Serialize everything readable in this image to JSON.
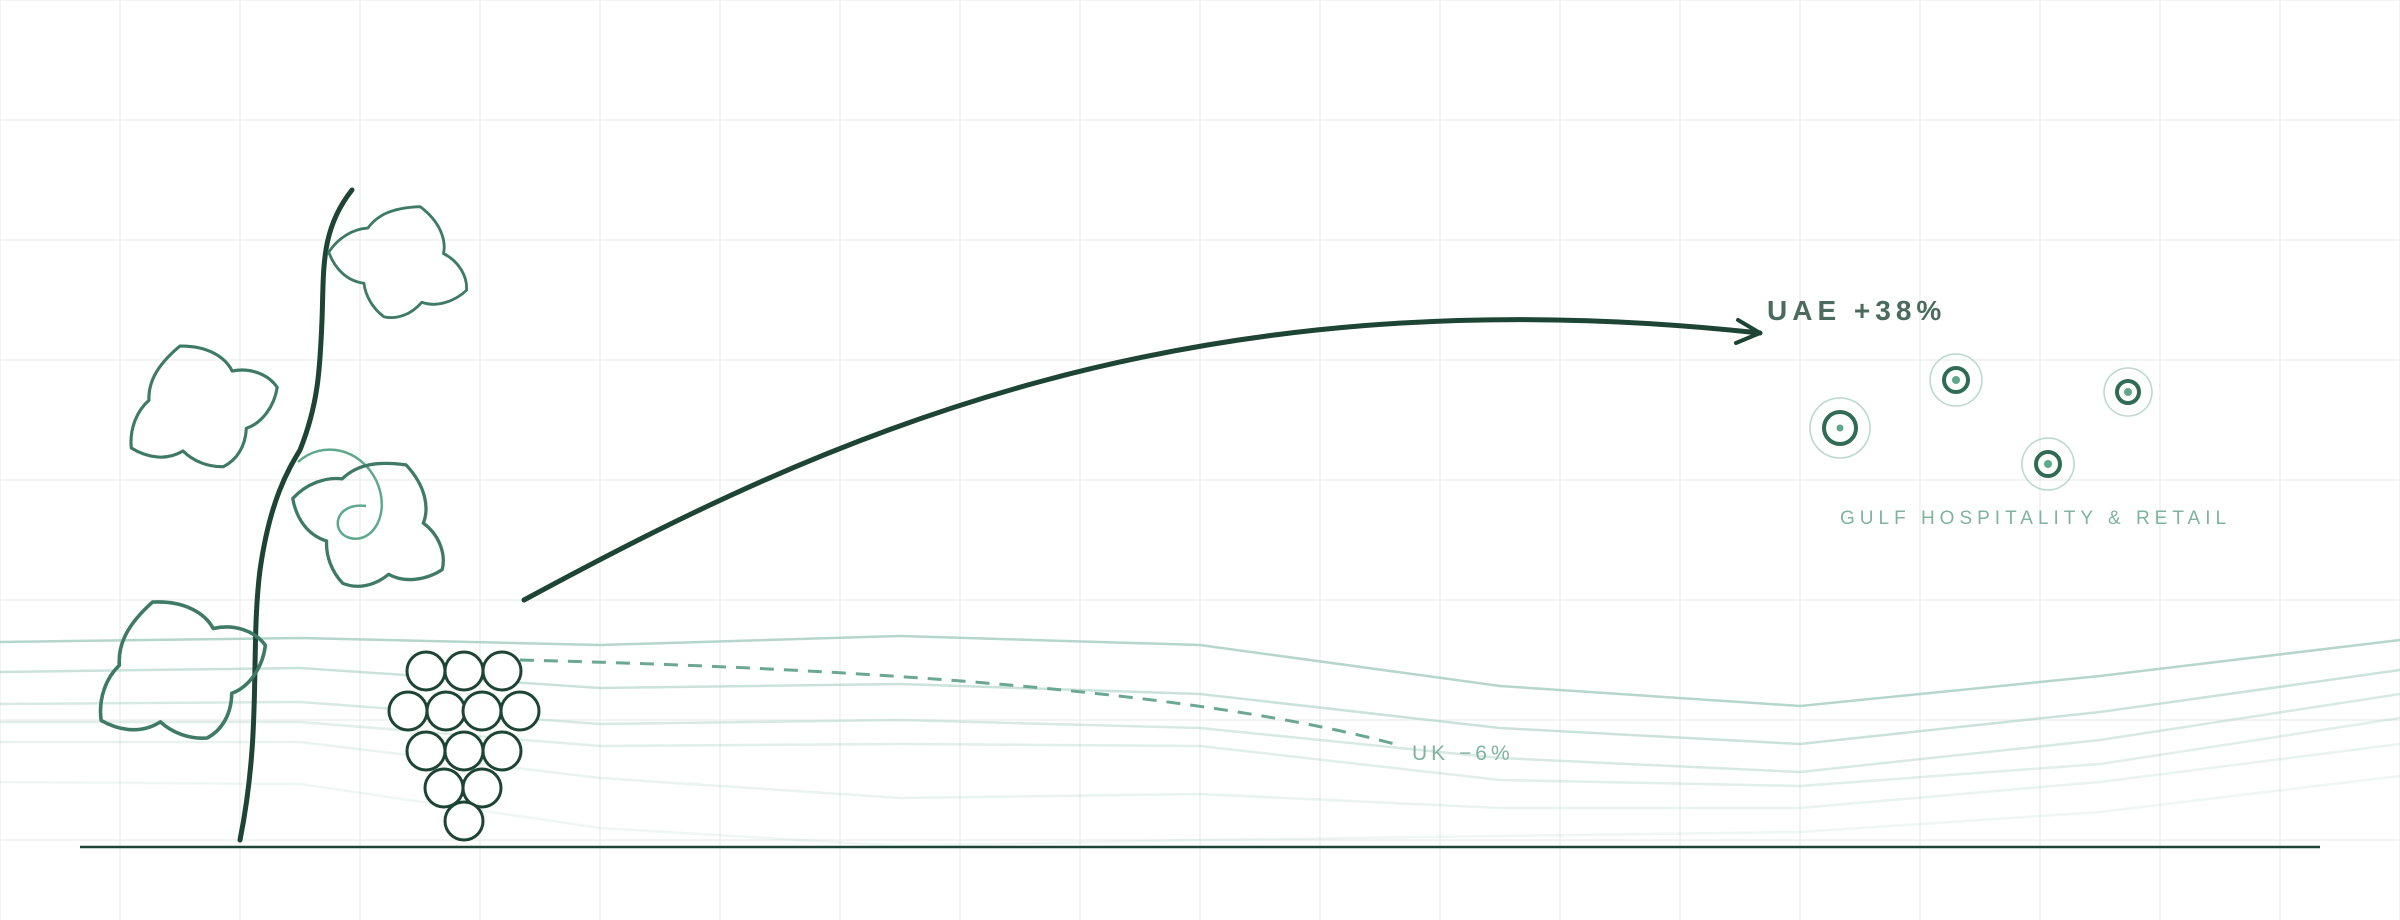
{
  "colors": {
    "ink": "#1d4434",
    "leaf": "#3f7a66",
    "accent": "#5fa88d",
    "label_dark": "#4b6b5f",
    "label_light": "#7fb39f",
    "grid": "#eef0ef",
    "wave": "#a9cfc4"
  },
  "icons": [
    "vine-stem-icon",
    "vine-leaf-icon",
    "vine-tendril-icon",
    "grape-cluster-icon",
    "location-target-icon"
  ],
  "labels": {
    "uae": "UAE +38%",
    "uk": "UK −6%",
    "gulf": "GULF HOSPITALITY & RETAIL"
  },
  "markers": [
    "market-point",
    "market-point",
    "market-point",
    "market-point"
  ]
}
